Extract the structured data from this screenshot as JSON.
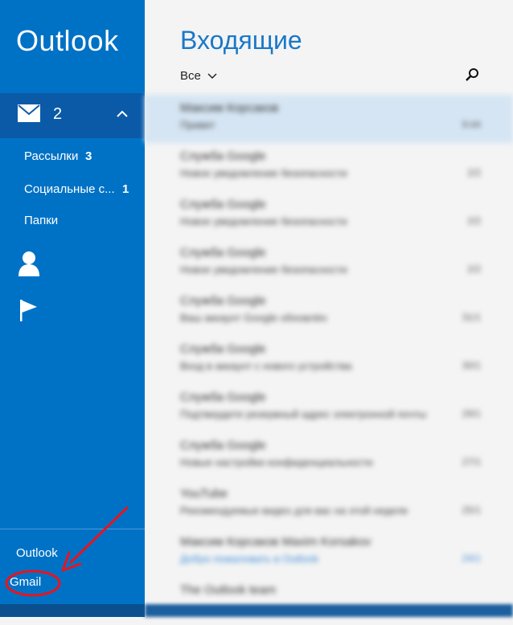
{
  "app": {
    "title": "Outlook"
  },
  "sidebar": {
    "mail_count": "2",
    "folders": [
      {
        "label": "Рассылки",
        "count": "3"
      },
      {
        "label": "Социальные с...",
        "count": "1"
      },
      {
        "label": "Папки",
        "count": ""
      }
    ],
    "accounts": [
      "Outlook",
      "Gmail"
    ]
  },
  "main": {
    "title": "Входящие",
    "filter": "Все",
    "messages": [
      {
        "sender": "Максим Корсаков",
        "subject": "Привет",
        "date": "9:44"
      },
      {
        "sender": "Служба Google",
        "subject": "Новое уведомление безопасности",
        "date": "2/2"
      },
      {
        "sender": "Служба Google",
        "subject": "Новое уведомление безопасности",
        "date": "2/2"
      },
      {
        "sender": "Служба Google",
        "subject": "Новое уведомление безопасности",
        "date": "2/2"
      },
      {
        "sender": "Служба Google",
        "subject": "Ваш аккаунт Google обновлён",
        "date": "31/1"
      },
      {
        "sender": "Служба Google",
        "subject": "Вход в аккаунт с нового устройства",
        "date": "30/1"
      },
      {
        "sender": "Служба Google",
        "subject": "Подтвердите резервный адрес электронной почты",
        "date": "29/1"
      },
      {
        "sender": "Служба Google",
        "subject": "Новые настройки конфиденциальности",
        "date": "27/1"
      },
      {
        "sender": "YouTube",
        "subject": "Рекомендуемые видео для вас на этой неделе",
        "date": "25/1"
      },
      {
        "sender": "Максим Корсаков Maxim Korsakov",
        "subject": "Добро пожаловать в Outlook",
        "date": "24/1"
      },
      {
        "sender": "The Outlook team",
        "subject": "",
        "date": ""
      }
    ]
  },
  "colors": {
    "sidebar": "#0072c6",
    "accent": "#1a78c8",
    "annotation": "#e8141e"
  }
}
